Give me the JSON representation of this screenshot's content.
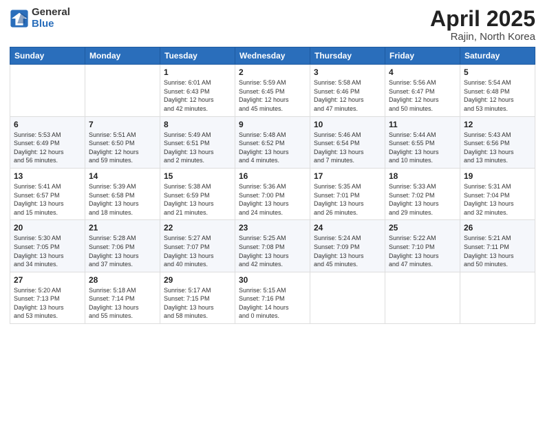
{
  "logo": {
    "general": "General",
    "blue": "Blue"
  },
  "title": "April 2025",
  "location": "Rajin, North Korea",
  "days_of_week": [
    "Sunday",
    "Monday",
    "Tuesday",
    "Wednesday",
    "Thursday",
    "Friday",
    "Saturday"
  ],
  "weeks": [
    [
      {
        "day": "",
        "info": ""
      },
      {
        "day": "",
        "info": ""
      },
      {
        "day": "1",
        "info": "Sunrise: 6:01 AM\nSunset: 6:43 PM\nDaylight: 12 hours\nand 42 minutes."
      },
      {
        "day": "2",
        "info": "Sunrise: 5:59 AM\nSunset: 6:45 PM\nDaylight: 12 hours\nand 45 minutes."
      },
      {
        "day": "3",
        "info": "Sunrise: 5:58 AM\nSunset: 6:46 PM\nDaylight: 12 hours\nand 47 minutes."
      },
      {
        "day": "4",
        "info": "Sunrise: 5:56 AM\nSunset: 6:47 PM\nDaylight: 12 hours\nand 50 minutes."
      },
      {
        "day": "5",
        "info": "Sunrise: 5:54 AM\nSunset: 6:48 PM\nDaylight: 12 hours\nand 53 minutes."
      }
    ],
    [
      {
        "day": "6",
        "info": "Sunrise: 5:53 AM\nSunset: 6:49 PM\nDaylight: 12 hours\nand 56 minutes."
      },
      {
        "day": "7",
        "info": "Sunrise: 5:51 AM\nSunset: 6:50 PM\nDaylight: 12 hours\nand 59 minutes."
      },
      {
        "day": "8",
        "info": "Sunrise: 5:49 AM\nSunset: 6:51 PM\nDaylight: 13 hours\nand 2 minutes."
      },
      {
        "day": "9",
        "info": "Sunrise: 5:48 AM\nSunset: 6:52 PM\nDaylight: 13 hours\nand 4 minutes."
      },
      {
        "day": "10",
        "info": "Sunrise: 5:46 AM\nSunset: 6:54 PM\nDaylight: 13 hours\nand 7 minutes."
      },
      {
        "day": "11",
        "info": "Sunrise: 5:44 AM\nSunset: 6:55 PM\nDaylight: 13 hours\nand 10 minutes."
      },
      {
        "day": "12",
        "info": "Sunrise: 5:43 AM\nSunset: 6:56 PM\nDaylight: 13 hours\nand 13 minutes."
      }
    ],
    [
      {
        "day": "13",
        "info": "Sunrise: 5:41 AM\nSunset: 6:57 PM\nDaylight: 13 hours\nand 15 minutes."
      },
      {
        "day": "14",
        "info": "Sunrise: 5:39 AM\nSunset: 6:58 PM\nDaylight: 13 hours\nand 18 minutes."
      },
      {
        "day": "15",
        "info": "Sunrise: 5:38 AM\nSunset: 6:59 PM\nDaylight: 13 hours\nand 21 minutes."
      },
      {
        "day": "16",
        "info": "Sunrise: 5:36 AM\nSunset: 7:00 PM\nDaylight: 13 hours\nand 24 minutes."
      },
      {
        "day": "17",
        "info": "Sunrise: 5:35 AM\nSunset: 7:01 PM\nDaylight: 13 hours\nand 26 minutes."
      },
      {
        "day": "18",
        "info": "Sunrise: 5:33 AM\nSunset: 7:02 PM\nDaylight: 13 hours\nand 29 minutes."
      },
      {
        "day": "19",
        "info": "Sunrise: 5:31 AM\nSunset: 7:04 PM\nDaylight: 13 hours\nand 32 minutes."
      }
    ],
    [
      {
        "day": "20",
        "info": "Sunrise: 5:30 AM\nSunset: 7:05 PM\nDaylight: 13 hours\nand 34 minutes."
      },
      {
        "day": "21",
        "info": "Sunrise: 5:28 AM\nSunset: 7:06 PM\nDaylight: 13 hours\nand 37 minutes."
      },
      {
        "day": "22",
        "info": "Sunrise: 5:27 AM\nSunset: 7:07 PM\nDaylight: 13 hours\nand 40 minutes."
      },
      {
        "day": "23",
        "info": "Sunrise: 5:25 AM\nSunset: 7:08 PM\nDaylight: 13 hours\nand 42 minutes."
      },
      {
        "day": "24",
        "info": "Sunrise: 5:24 AM\nSunset: 7:09 PM\nDaylight: 13 hours\nand 45 minutes."
      },
      {
        "day": "25",
        "info": "Sunrise: 5:22 AM\nSunset: 7:10 PM\nDaylight: 13 hours\nand 47 minutes."
      },
      {
        "day": "26",
        "info": "Sunrise: 5:21 AM\nSunset: 7:11 PM\nDaylight: 13 hours\nand 50 minutes."
      }
    ],
    [
      {
        "day": "27",
        "info": "Sunrise: 5:20 AM\nSunset: 7:13 PM\nDaylight: 13 hours\nand 53 minutes."
      },
      {
        "day": "28",
        "info": "Sunrise: 5:18 AM\nSunset: 7:14 PM\nDaylight: 13 hours\nand 55 minutes."
      },
      {
        "day": "29",
        "info": "Sunrise: 5:17 AM\nSunset: 7:15 PM\nDaylight: 13 hours\nand 58 minutes."
      },
      {
        "day": "30",
        "info": "Sunrise: 5:15 AM\nSunset: 7:16 PM\nDaylight: 14 hours\nand 0 minutes."
      },
      {
        "day": "",
        "info": ""
      },
      {
        "day": "",
        "info": ""
      },
      {
        "day": "",
        "info": ""
      }
    ]
  ]
}
